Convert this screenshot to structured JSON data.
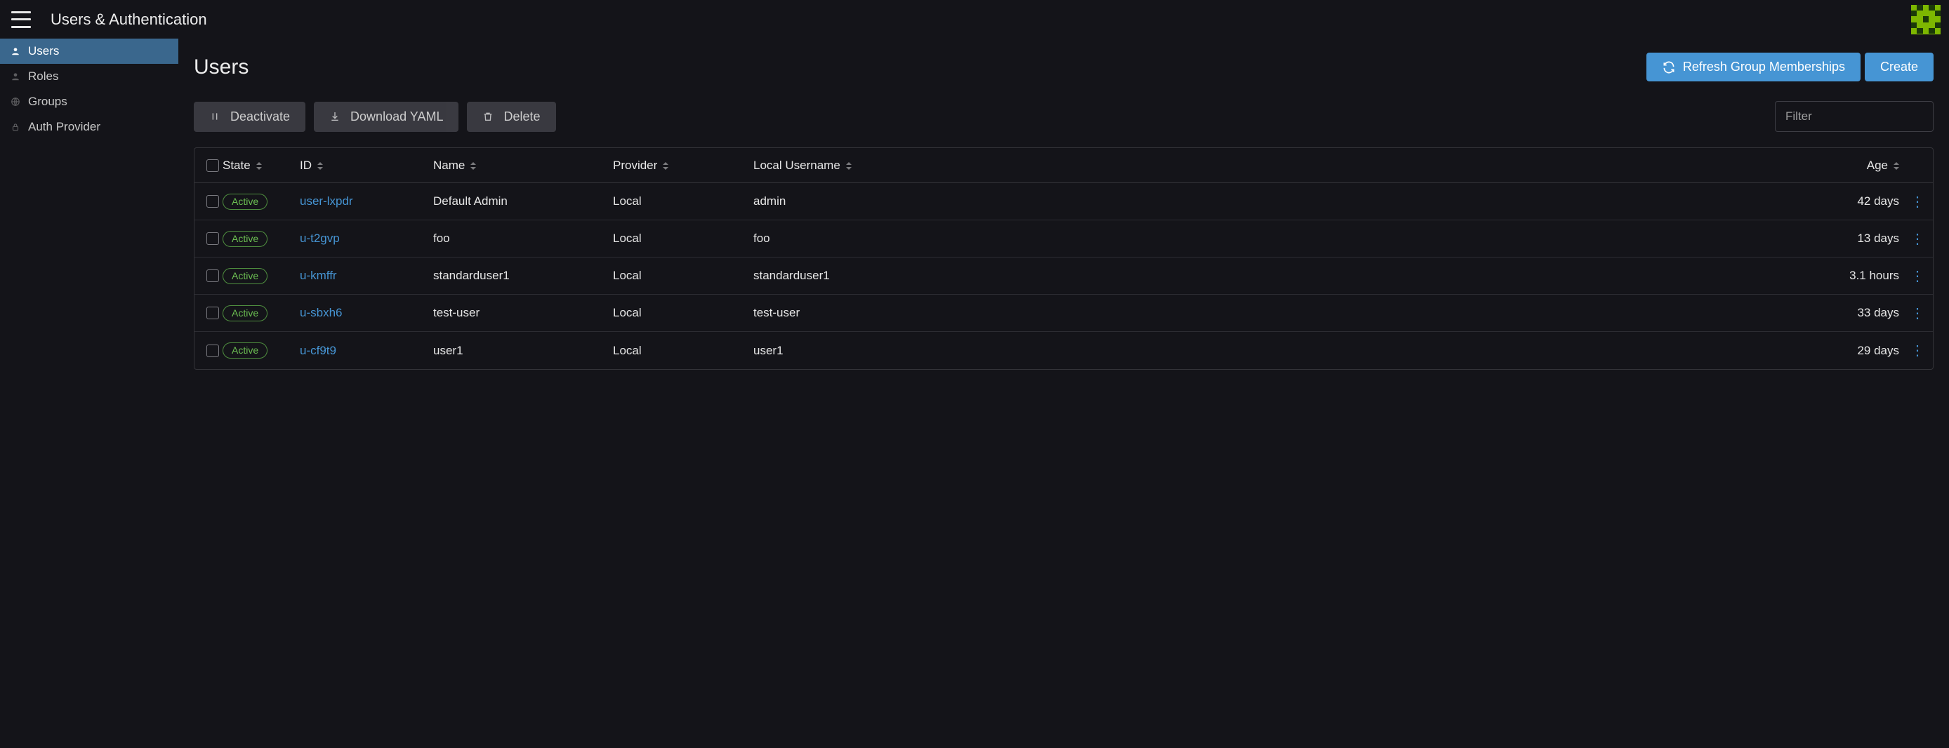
{
  "header": {
    "title": "Users & Authentication"
  },
  "sidebar": {
    "items": [
      {
        "label": "Users",
        "icon": "person-icon",
        "active": true
      },
      {
        "label": "Roles",
        "icon": "person-icon",
        "active": false
      },
      {
        "label": "Groups",
        "icon": "globe-icon",
        "active": false
      },
      {
        "label": "Auth Provider",
        "icon": "lock-icon",
        "active": false
      }
    ]
  },
  "page": {
    "title": "Users",
    "refresh_label": "Refresh Group Memberships",
    "create_label": "Create"
  },
  "toolbar": {
    "deactivate_label": "Deactivate",
    "download_label": "Download YAML",
    "delete_label": "Delete",
    "filter_placeholder": "Filter"
  },
  "table": {
    "columns": {
      "state": "State",
      "id": "ID",
      "name": "Name",
      "provider": "Provider",
      "local_username": "Local Username",
      "age": "Age"
    },
    "rows": [
      {
        "state": "Active",
        "id": "user-lxpdr",
        "name": "Default Admin",
        "provider": "Local",
        "local_username": "admin",
        "age": "42 days"
      },
      {
        "state": "Active",
        "id": "u-t2gvp",
        "name": "foo",
        "provider": "Local",
        "local_username": "foo",
        "age": "13 days"
      },
      {
        "state": "Active",
        "id": "u-kmffr",
        "name": "standarduser1",
        "provider": "Local",
        "local_username": "standarduser1",
        "age": "3.1 hours"
      },
      {
        "state": "Active",
        "id": "u-sbxh6",
        "name": "test-user",
        "provider": "Local",
        "local_username": "test-user",
        "age": "33 days"
      },
      {
        "state": "Active",
        "id": "u-cf9t9",
        "name": "user1",
        "provider": "Local",
        "local_username": "user1",
        "age": "29 days"
      }
    ]
  }
}
